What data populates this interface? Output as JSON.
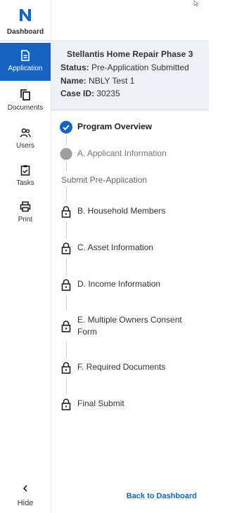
{
  "sidebar": {
    "brand_label": "Dashboard",
    "items": [
      {
        "label": "Application",
        "icon": "document-icon",
        "active": true
      },
      {
        "label": "Documents",
        "icon": "copy-icon",
        "active": false
      },
      {
        "label": "Users",
        "icon": "users-icon",
        "active": false
      },
      {
        "label": "Tasks",
        "icon": "clipboard-check-icon",
        "active": false
      },
      {
        "label": "Print",
        "icon": "printer-icon",
        "active": false
      }
    ],
    "hide_label": "Hide"
  },
  "header": {
    "program_title": "Stellantis Home Repair Phase 3",
    "status_label": "Status:",
    "status_value": "Pre-Application Submitted",
    "name_label": "Name:",
    "name_value": "NBLY Test 1",
    "case_label": "Case ID:",
    "case_value": "30235"
  },
  "steps": {
    "overview": "Program Overview",
    "applicant": "A. Applicant Information",
    "submit_pre": "Submit Pre-Application",
    "household": "B. Household Members",
    "asset": "C. Asset Information",
    "income": "D. Income Information",
    "owners_consent": "E. Multiple Owners Consent Form",
    "required_docs": "F. Required Documents",
    "final_submit": "Final Submit"
  },
  "footer": {
    "back_label": "Back to Dashboard"
  },
  "colors": {
    "accent": "#1565c0",
    "header_bg": "#eef1f6",
    "pending_grey": "#9e9e9e"
  }
}
